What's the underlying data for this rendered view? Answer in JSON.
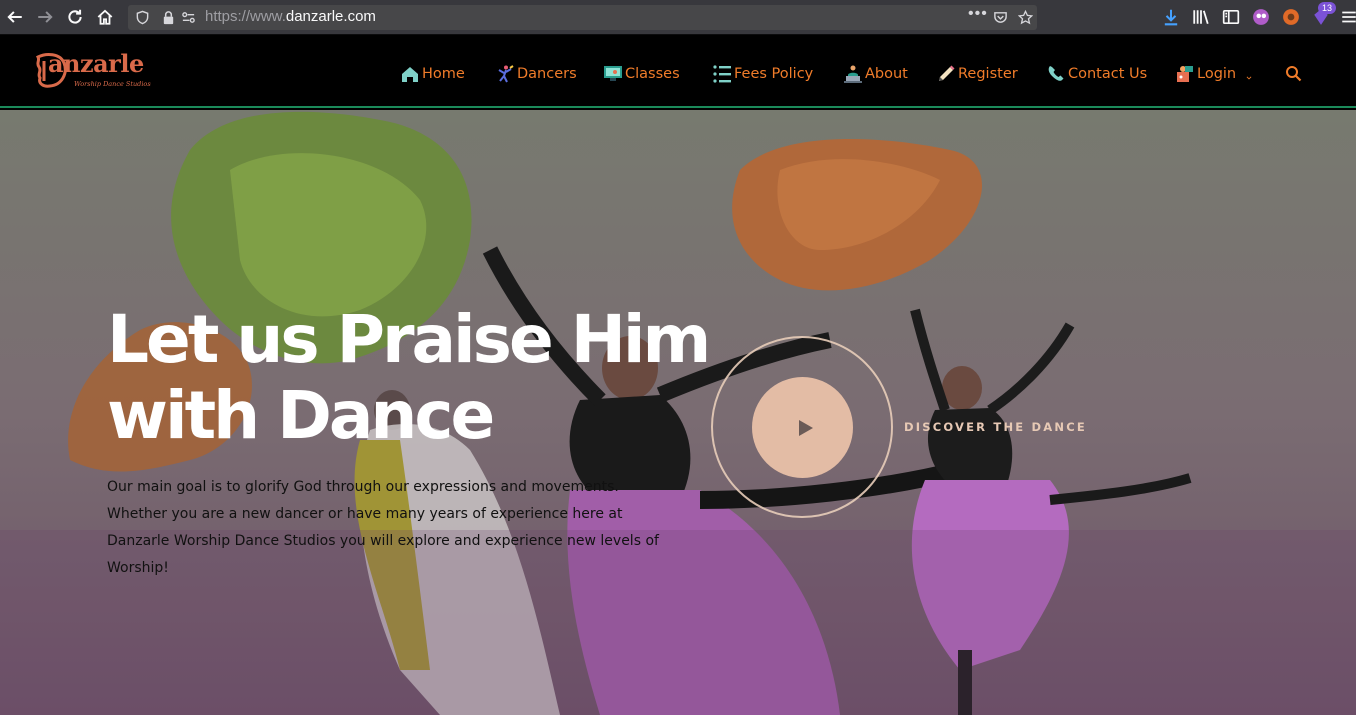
{
  "browser": {
    "url_protocol": "https://www.",
    "url_host": "danzarle.com",
    "url_more": "•••",
    "extension_badge": "13"
  },
  "site": {
    "logo_text": "anzarle",
    "logo_tagline": "Worship Dance Studios",
    "brand_color": "#f07c2a",
    "nav": [
      {
        "label": "Home",
        "icon": "home-icon"
      },
      {
        "label": "Dancers",
        "icon": "dancer-icon"
      },
      {
        "label": "Classes",
        "icon": "monitor-icon"
      },
      {
        "label": "Fees Policy",
        "icon": "list-icon"
      },
      {
        "label": "About",
        "icon": "person-laptop-icon"
      },
      {
        "label": "Register",
        "icon": "pencil-icon"
      },
      {
        "label": "Contact Us",
        "icon": "phone-icon"
      },
      {
        "label": "Login",
        "icon": "login-icon"
      }
    ]
  },
  "hero": {
    "title_line1": "Let us Praise Him",
    "title_line2": "with Dance",
    "body": "Our main goal is to glorify God through our expressions and movements. Whether you are a new dancer or have many years of experience here at Danzarle Worship Dance Studios you will explore and experience new levels of Worship!",
    "cta": "DISCOVER THE DANCE",
    "play_color": "#e3bca5"
  }
}
